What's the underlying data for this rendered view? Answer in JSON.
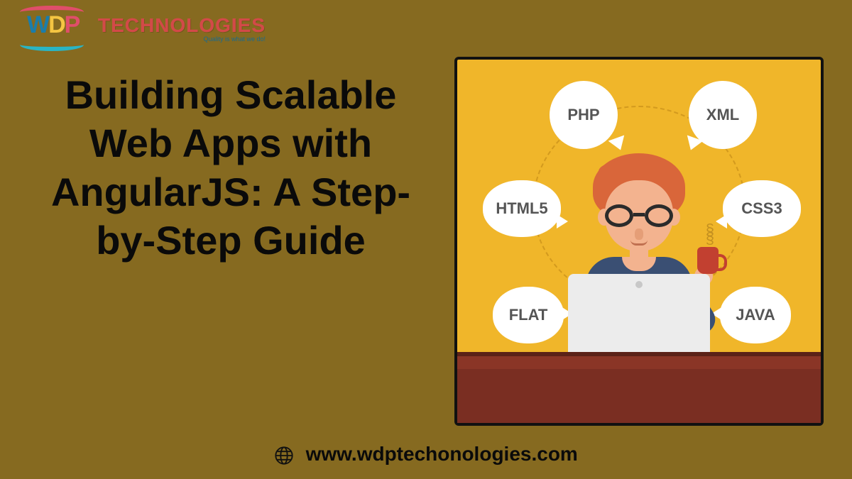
{
  "logo": {
    "mark": "WDP",
    "brand": "TECHNOLOGIES",
    "tagline": "Quality is what we do!"
  },
  "title": "Building Scalable Web Apps with AngularJS: A Step-by-Step Guide",
  "bubbles": {
    "tl": "PHP",
    "tr": "XML",
    "ml": "HTML5",
    "mr": "CSS3",
    "bl": "FLAT",
    "br": "JAVA"
  },
  "footer": {
    "url": "www.wdptechonologies.com"
  }
}
